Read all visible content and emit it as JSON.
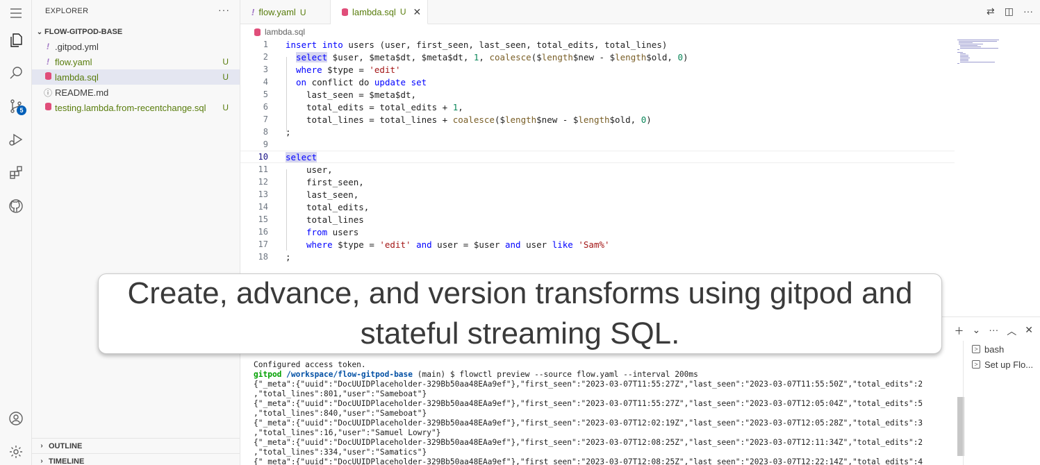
{
  "sidebar": {
    "title": "EXPLORER",
    "more": "···",
    "folder": "FLOW-GITPOD-BASE",
    "files": [
      {
        "icon": "!",
        "name": ".gitpod.yml",
        "status": ""
      },
      {
        "icon": "!",
        "name": "flow.yaml",
        "status": "U"
      },
      {
        "icon": "",
        "name": "lambda.sql",
        "status": "U"
      },
      {
        "icon": "ⓘ",
        "name": "README.md",
        "status": ""
      },
      {
        "icon": "",
        "name": "testing.lambda.from-recentchange.sql",
        "status": "U"
      }
    ],
    "outline": "OUTLINE",
    "timeline": "TIMELINE"
  },
  "activity": {
    "scm_badge": "5"
  },
  "tabs": [
    {
      "icon": "!",
      "label": "flow.yaml",
      "status": "U"
    },
    {
      "icon": "",
      "label": "lambda.sql",
      "status": "U",
      "close": "✕"
    }
  ],
  "breadcrumb": "lambda.sql",
  "editor": {
    "line_numbers": [
      "1",
      "2",
      "3",
      "4",
      "5",
      "6",
      "7",
      "8",
      "9",
      "10",
      "11",
      "12",
      "13",
      "14",
      "15",
      "16",
      "17",
      "18"
    ],
    "lines": [
      [
        "insert",
        " ",
        "into",
        " users (user, first_seen, last_seen, total_edits, total_lines)"
      ],
      [
        "select",
        " $user, $meta$dt, $meta$dt, ",
        "1",
        ", ",
        "coalesce",
        "($",
        "length",
        "$new - $",
        "length",
        "$old, ",
        "0",
        ")"
      ],
      [
        "where",
        " $type = ",
        "'edit'"
      ],
      [
        "on",
        " conflict do ",
        "update",
        " ",
        "set"
      ],
      [
        "last_seen = $meta$dt,"
      ],
      [
        "total_edits = total_edits + ",
        "1",
        ","
      ],
      [
        "total_lines = total_lines + ",
        "coalesce",
        "($",
        "length",
        "$new - $",
        "length",
        "$old, ",
        "0",
        ")"
      ],
      [
        ";"
      ],
      [
        ""
      ],
      [
        "select"
      ],
      [
        "user,"
      ],
      [
        "first_seen,"
      ],
      [
        "last_seen,"
      ],
      [
        "total_edits,"
      ],
      [
        "total_lines"
      ],
      [
        "from",
        " users"
      ],
      [
        "where",
        " $type = ",
        "'edit'",
        " ",
        "and",
        " user = $user ",
        "and",
        " user ",
        "like",
        " ",
        "'Sam%'"
      ],
      [
        ";"
      ]
    ]
  },
  "terminal": {
    "lines": [
      "Configured access token.",
      "{\"_meta\":{\"uuid\":\"DocUUIDPlaceholder-329Bb50aa48EAa9ef\"},\"first_seen\":\"2023-03-07T11:55:27Z\",\"last_seen\":\"2023-03-07T11:55:50Z\",\"total_edits\":2",
      ",\"total_lines\":801,\"user\":\"Sameboat\"}",
      "{\"_meta\":{\"uuid\":\"DocUUIDPlaceholder-329Bb50aa48EAa9ef\"},\"first_seen\":\"2023-03-07T11:55:27Z\",\"last_seen\":\"2023-03-07T12:05:04Z\",\"total_edits\":5",
      ",\"total_lines\":840,\"user\":\"Sameboat\"}",
      "{\"_meta\":{\"uuid\":\"DocUUIDPlaceholder-329Bb50aa48EAa9ef\"},\"first_seen\":\"2023-03-07T12:02:19Z\",\"last_seen\":\"2023-03-07T12:05:28Z\",\"total_edits\":3",
      ",\"total_lines\":16,\"user\":\"Samuel Lowry\"}",
      "{\"_meta\":{\"uuid\":\"DocUUIDPlaceholder-329Bb50aa48EAa9ef\"},\"first_seen\":\"2023-03-07T12:08:25Z\",\"last_seen\":\"2023-03-07T12:11:34Z\",\"total_edits\":2",
      ",\"total_lines\":334,\"user\":\"Samatics\"}",
      "{\"_meta\":{\"uuid\":\"DocUUIDPlaceholder-329Bb50aa48EAa9ef\"},\"first_seen\":\"2023-03-07T12:08:25Z\",\"last_seen\":\"2023-03-07T12:22:14Z\",\"total_edits\":4"
    ],
    "prompt_user": "gitpod",
    "prompt_path": "/workspace/flow-gitpod-base",
    "prompt_rest": " (main) $ flowctl preview --source flow.yaml --interval 200ms",
    "sessions": [
      "bash",
      "Set up Flo..."
    ]
  },
  "caption": "Create, advance, and version transforms using gitpod and stateful streaming SQL.",
  "colors": {
    "accent": "#005fb8",
    "keyword": "#0000ff",
    "string": "#a31515",
    "number": "#098658",
    "function": "#795e26",
    "untracked": "#587c0c"
  }
}
